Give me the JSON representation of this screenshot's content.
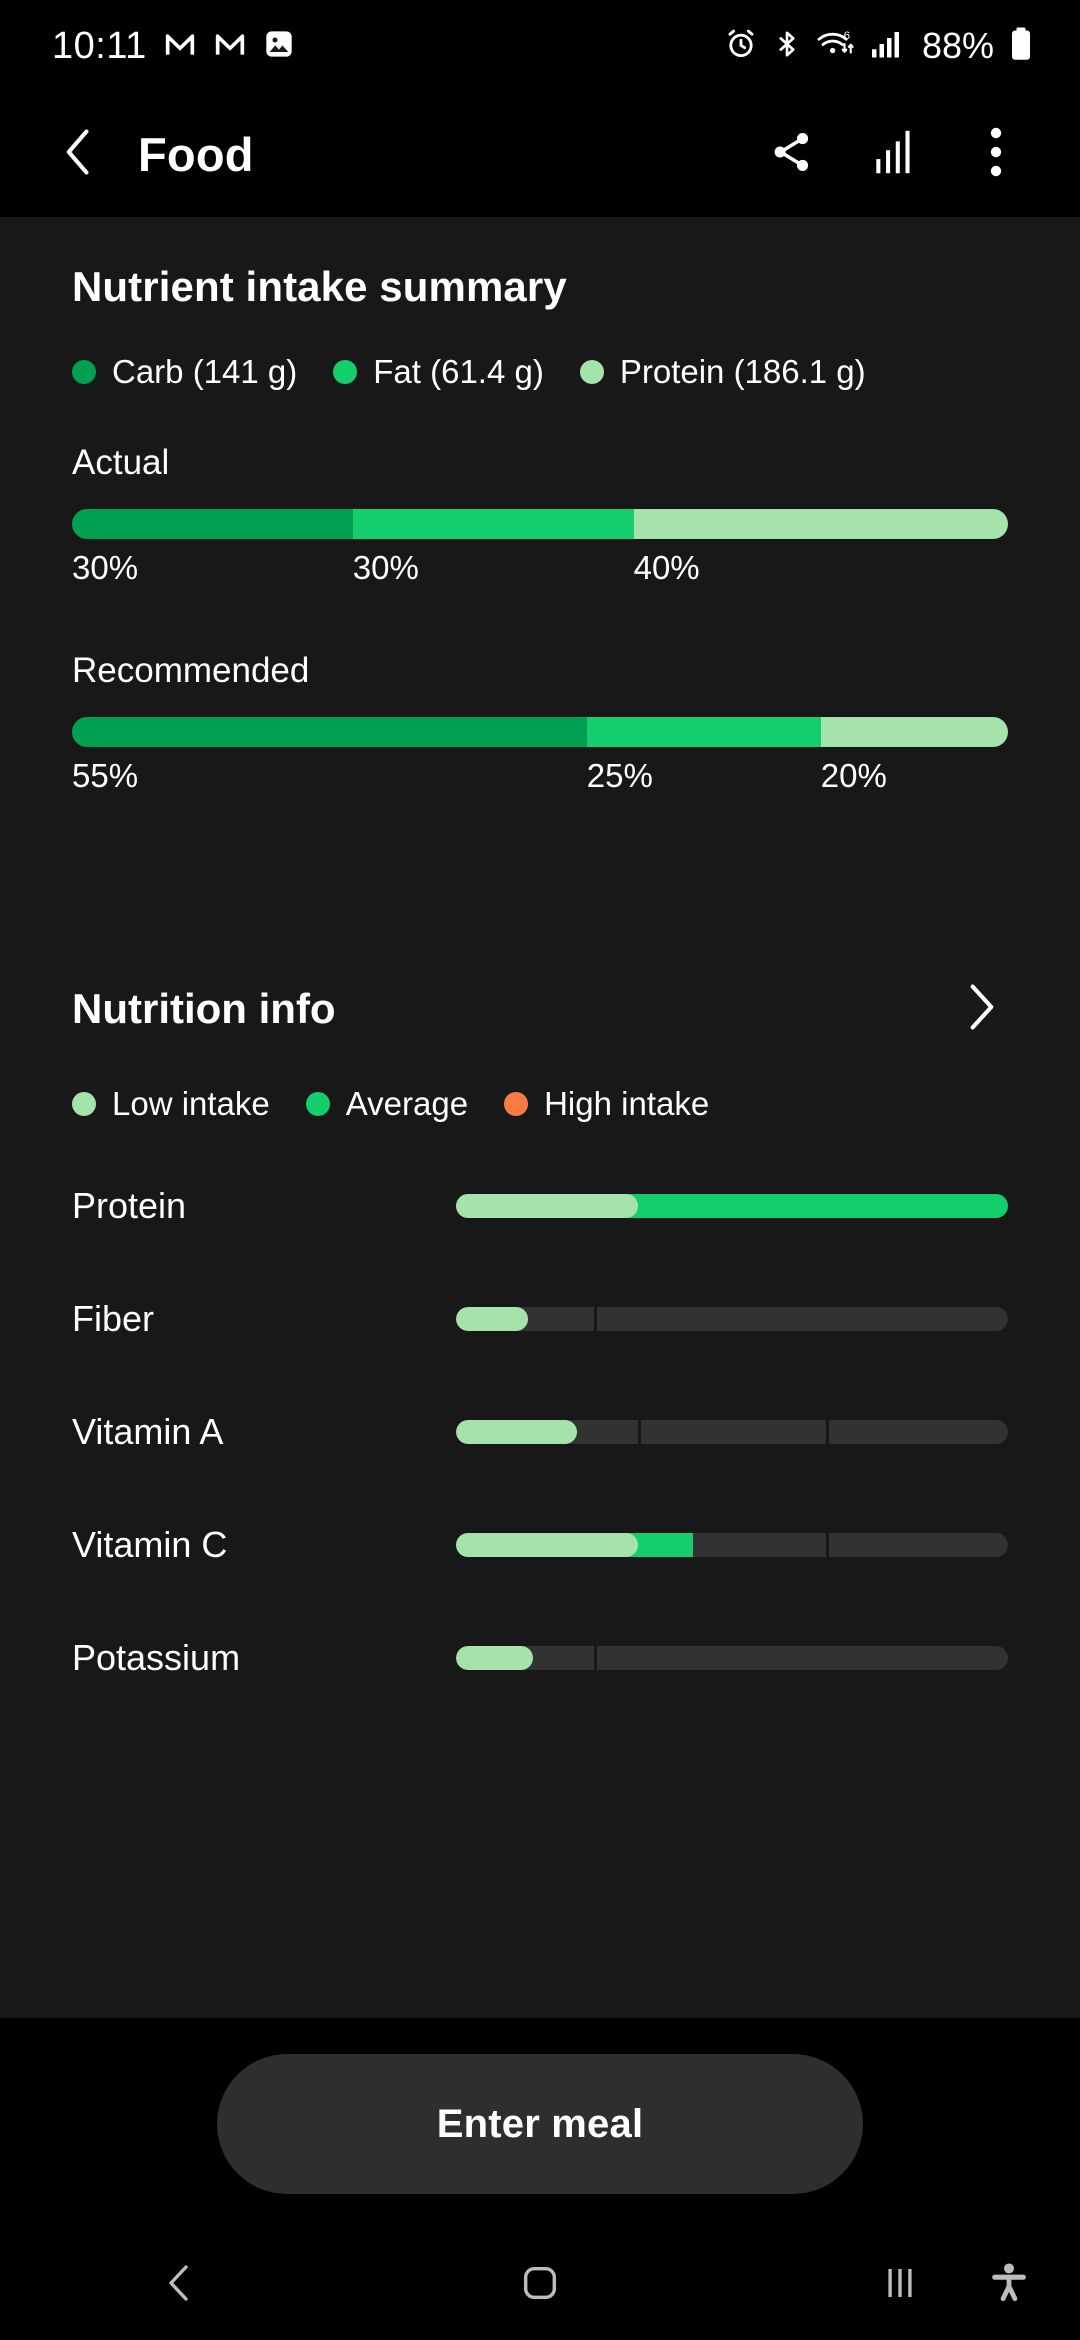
{
  "status_bar": {
    "time": "10:11",
    "battery_percent": "88%",
    "left_icons": [
      "gmail-icon",
      "gmail-icon",
      "gallery-image-icon"
    ],
    "right_icons": [
      "alarm-clock-icon",
      "bluetooth-icon",
      "wifi-6-icon",
      "cellular-signal-icon",
      "battery-icon"
    ]
  },
  "app_bar": {
    "title": "Food",
    "back_icon": "chevron-left-icon",
    "share_icon": "share-icon",
    "chart_icon": "bar-chart-icon",
    "more_icon": "more-vertical-icon"
  },
  "colors": {
    "carb_green": "#00A053",
    "fat_green": "#14CE6E",
    "protein_green": "#A6E3AC",
    "low_intake": "#A6E3AC",
    "average": "#14CE6E",
    "high_intake": "#F97C45",
    "track": "#323232",
    "surface": "#181818",
    "background": "#000000"
  },
  "summary": {
    "title": "Nutrient intake summary",
    "legend": [
      {
        "label": "Carb (141 g)",
        "color": "#00A053"
      },
      {
        "label": "Fat (61.4 g)",
        "color": "#14CE6E"
      },
      {
        "label": "Protein (186.1 g)",
        "color": "#A6E3AC"
      }
    ],
    "actual": {
      "caption": "Actual",
      "segments": [
        {
          "label": "30%",
          "value": 30,
          "color": "#00A053"
        },
        {
          "label": "30%",
          "value": 30,
          "color": "#14CE6E"
        },
        {
          "label": "40%",
          "value": 40,
          "color": "#A6E3AC"
        }
      ]
    },
    "recommended": {
      "caption": "Recommended",
      "segments": [
        {
          "label": "55%",
          "value": 55,
          "color": "#00A053"
        },
        {
          "label": "25%",
          "value": 25,
          "color": "#14CE6E"
        },
        {
          "label": "20%",
          "value": 20,
          "color": "#A6E3AC"
        }
      ]
    }
  },
  "nutrition_info": {
    "title": "Nutrition info",
    "chevron_icon": "chevron-right-icon",
    "legend": [
      {
        "label": "Low intake",
        "color": "#A6E3AC"
      },
      {
        "label": "Average",
        "color": "#14CE6E"
      },
      {
        "label": "High intake",
        "color": "#F97C45"
      }
    ],
    "rows": [
      {
        "name": "Protein",
        "low_pct": 33,
        "avg_pct": 100,
        "dividers": []
      },
      {
        "name": "Fiber",
        "low_pct": 13,
        "avg_pct": 13,
        "dividers": [
          25
        ]
      },
      {
        "name": "Vitamin A",
        "low_pct": 22,
        "avg_pct": 22,
        "dividers": [
          33,
          67
        ]
      },
      {
        "name": "Vitamin C",
        "low_pct": 33,
        "avg_pct": 43,
        "dividers": [
          67
        ]
      },
      {
        "name": "Potassium",
        "low_pct": 14,
        "avg_pct": 14,
        "dividers": [
          25
        ]
      }
    ]
  },
  "footer": {
    "cta_label": "Enter meal"
  },
  "nav_bar": {
    "back_icon": "nav-back-icon",
    "home_icon": "nav-home-icon",
    "recents_icon": "nav-recents-icon",
    "accessibility_icon": "accessibility-icon"
  },
  "chart_data": [
    {
      "type": "bar",
      "title": "Nutrient intake summary",
      "orientation": "horizontal-stacked",
      "categories": [
        "Actual",
        "Recommended"
      ],
      "series": [
        {
          "name": "Carb (141 g)",
          "values": [
            30,
            55
          ],
          "color": "#00A053"
        },
        {
          "name": "Fat (61.4 g)",
          "values": [
            30,
            25
          ],
          "color": "#14CE6E"
        },
        {
          "name": "Protein (186.1 g)",
          "values": [
            40,
            20
          ],
          "color": "#A6E3AC"
        }
      ],
      "unit": "%",
      "xlabel": "",
      "ylabel": "",
      "xlim": [
        0,
        100
      ],
      "grid": false,
      "legend_position": "top"
    },
    {
      "type": "bar",
      "title": "Nutrition info",
      "orientation": "horizontal",
      "categories": [
        "Protein",
        "Fiber",
        "Vitamin A",
        "Vitamin C",
        "Potassium"
      ],
      "series": [
        {
          "name": "Low intake",
          "values": [
            33,
            13,
            22,
            33,
            14
          ],
          "color": "#A6E3AC"
        },
        {
          "name": "Average",
          "values": [
            67,
            0,
            0,
            10,
            0
          ],
          "color": "#14CE6E"
        }
      ],
      "unit": "%",
      "xlim": [
        0,
        100
      ],
      "grid": true,
      "legend_position": "top",
      "legend_entries": [
        "Low intake",
        "Average",
        "High intake"
      ]
    }
  ]
}
